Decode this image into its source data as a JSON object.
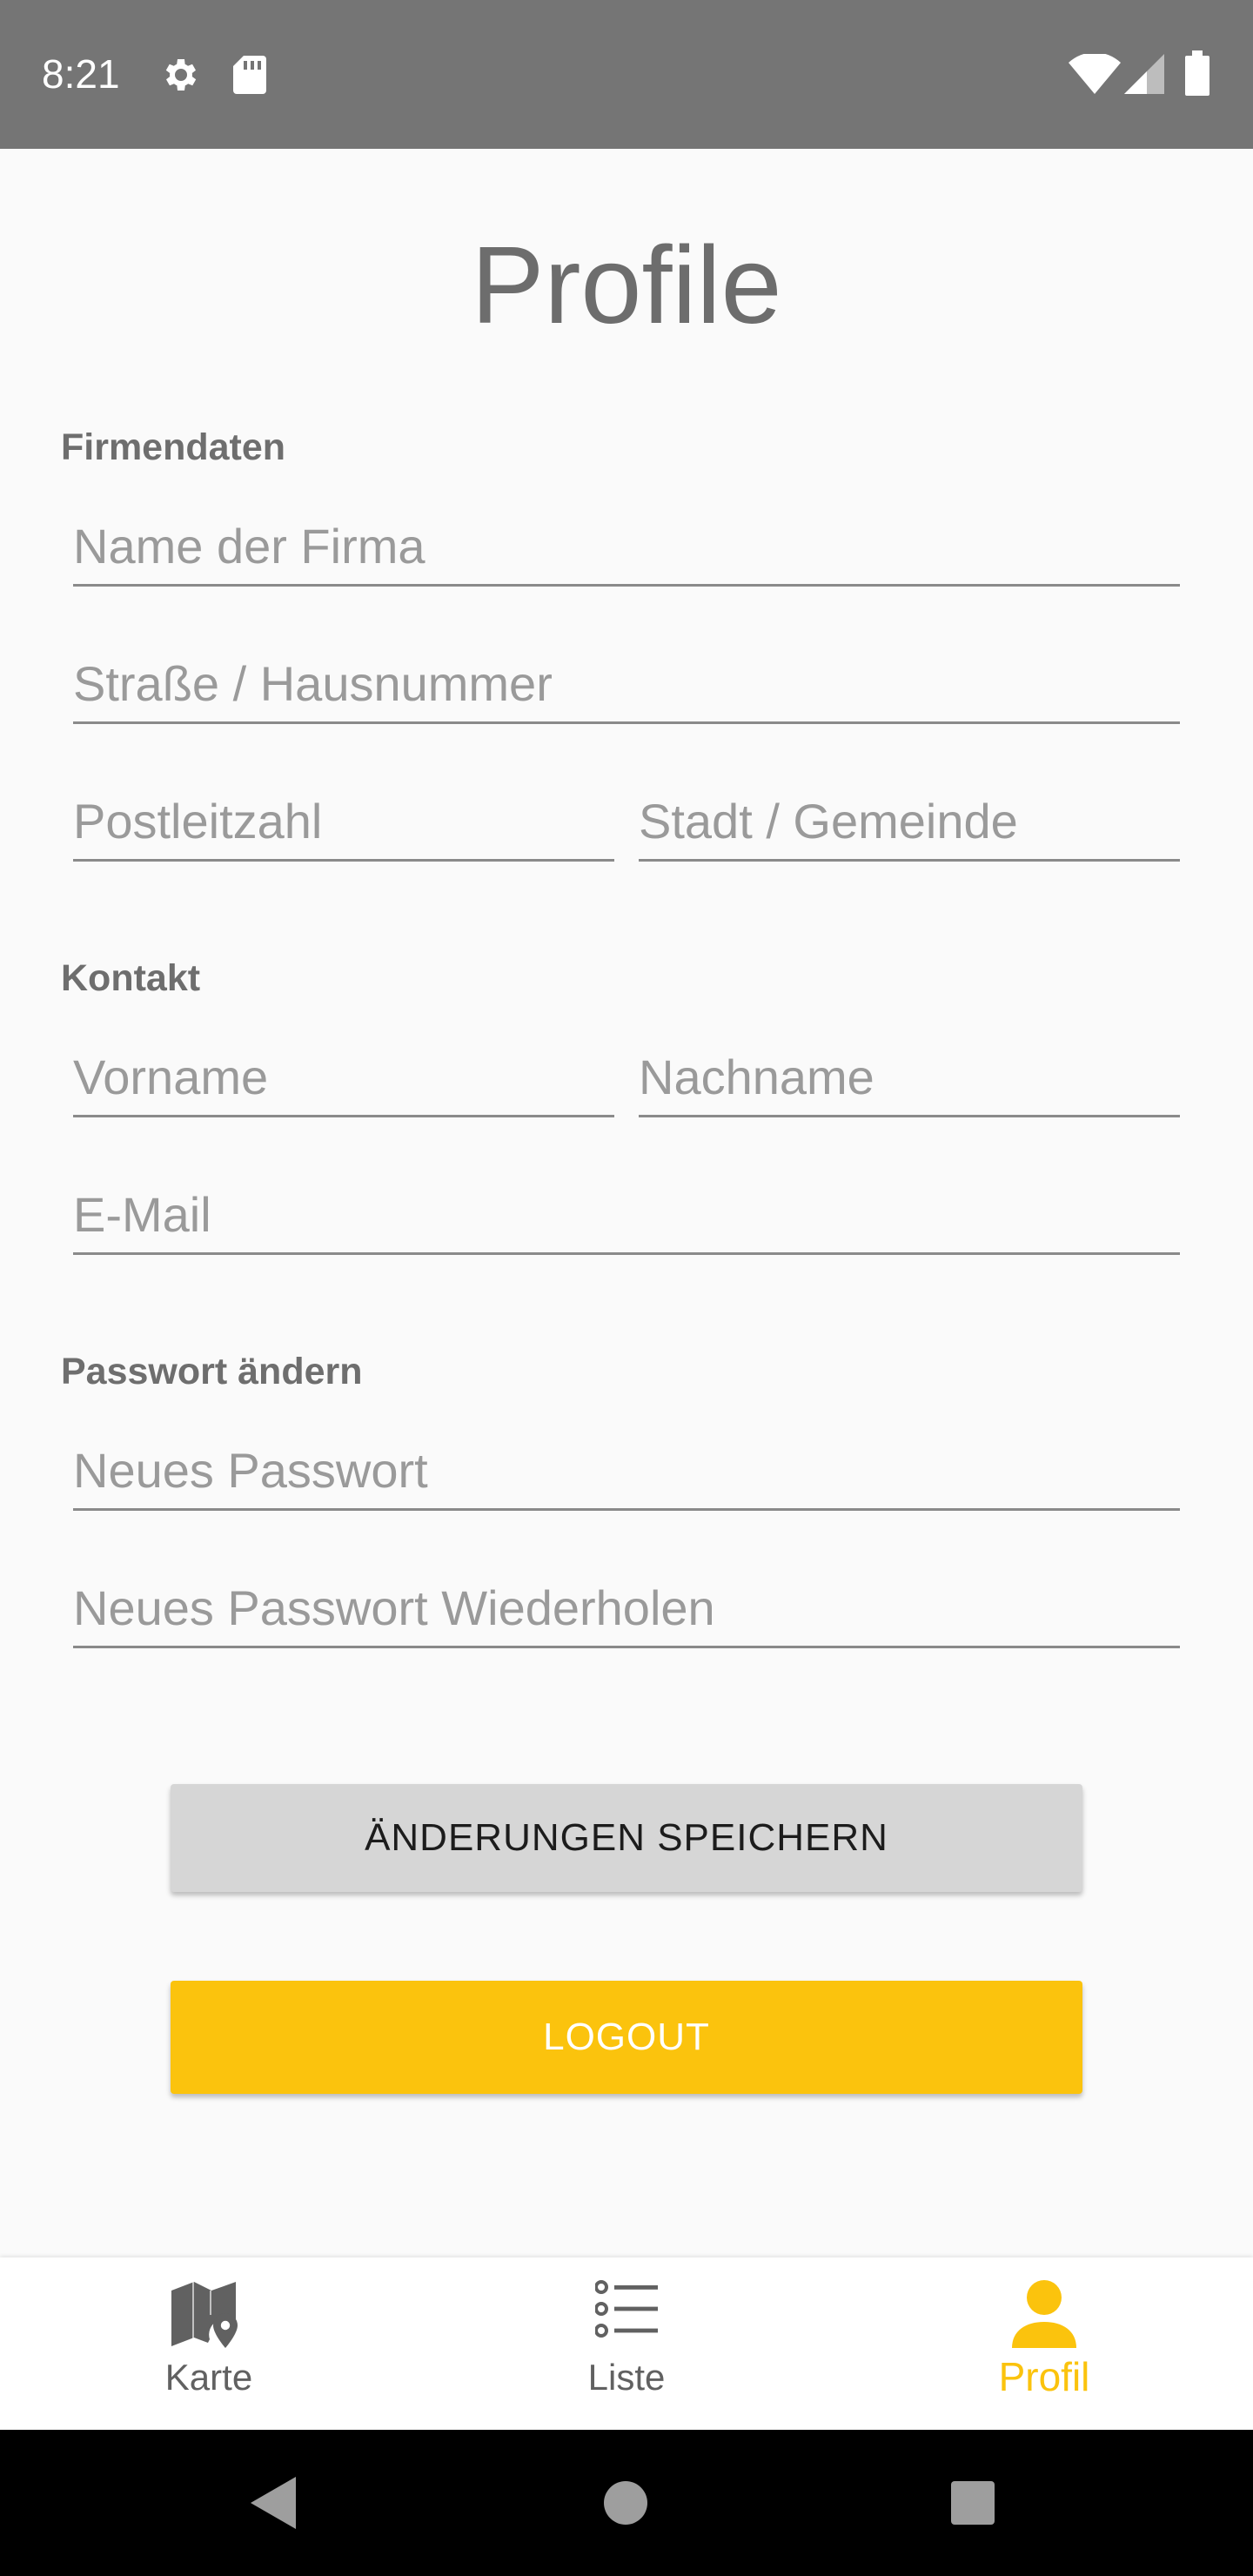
{
  "status_bar": {
    "time": "8:21",
    "icons": [
      "settings-gear-icon",
      "sd-card-icon",
      "wifi-icon",
      "cell-signal-icon",
      "battery-icon"
    ]
  },
  "title": "Profile",
  "sections": {
    "company": {
      "label": "Firmendaten",
      "company_name_placeholder": "Name der Firma",
      "street_placeholder": "Straße / Hausnummer",
      "zip_placeholder": "Postleitzahl",
      "city_placeholder": "Stadt / Gemeinde"
    },
    "contact": {
      "label": "Kontakt",
      "first_name_placeholder": "Vorname",
      "last_name_placeholder": "Nachname",
      "email_placeholder": "E-Mail"
    },
    "password": {
      "label": "Passwort ändern",
      "new_password_placeholder": "Neues Passwort",
      "repeat_password_placeholder": "Neues Passwort Wiederholen"
    }
  },
  "buttons": {
    "save_label": "ÄNDERUNGEN SPEICHERN",
    "logout_label": "LOGOUT"
  },
  "bottom_nav": {
    "items": [
      {
        "label": "Karte",
        "icon": "map-pin-icon",
        "active": false
      },
      {
        "label": "Liste",
        "icon": "list-icon",
        "active": false
      },
      {
        "label": "Profil",
        "icon": "person-icon",
        "active": true
      }
    ]
  },
  "colors": {
    "accent": "#fbc30d",
    "status_bar": "#757575",
    "save_button": "#d6d6d6",
    "background": "#fafafa"
  }
}
